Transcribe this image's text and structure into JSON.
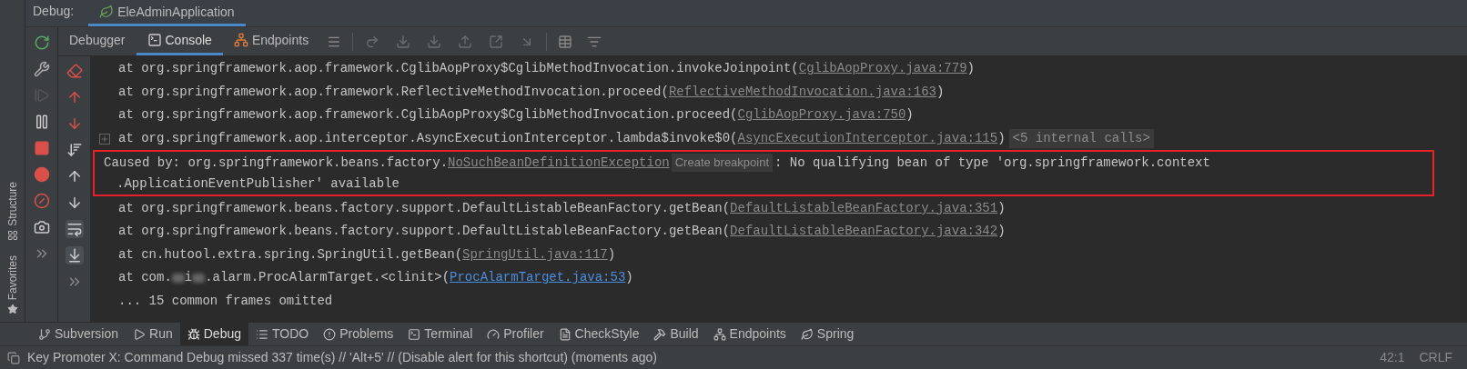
{
  "header": {
    "label": "Debug:",
    "tab": {
      "title": "EleAdminApplication",
      "selected": true
    }
  },
  "side_strip": [
    "Structure",
    "Favorites"
  ],
  "tabs": [
    {
      "label": "Debugger",
      "selected": false
    },
    {
      "label": "Console",
      "selected": true
    },
    {
      "label": "Endpoints",
      "selected": false
    }
  ],
  "console_lines": [
    {
      "kind": "frame",
      "text": "at org.springframework.aop.framework.CglibAopProxy$CglibMethodInvocation.invokeJoinpoint(",
      "link": "CglibAopProxy.java:779",
      "in_project": false,
      "close": ")"
    },
    {
      "kind": "frame",
      "text": "at org.springframework.aop.framework.ReflectiveMethodInvocation.proceed(",
      "link": "ReflectiveMethodInvocation.java:163",
      "in_project": false,
      "close": ")"
    },
    {
      "kind": "frame",
      "text": "at org.springframework.aop.framework.CglibAopProxy$CglibMethodInvocation.proceed(",
      "link": "CglibAopProxy.java:750",
      "in_project": false,
      "close": ")"
    },
    {
      "kind": "frame",
      "folded": true,
      "text": "at org.springframework.aop.interceptor.AsyncExecutionInterceptor.lambda$invoke$0(",
      "link": "AsyncExecutionInterceptor.java:115",
      "in_project": false,
      "close": ")",
      "badge": "<5 internal calls>"
    },
    {
      "kind": "caused",
      "highlighted": true,
      "prefix": "Caused by: org.springframework.beans.factory.",
      "exception": "NoSuchBeanDefinitionException",
      "hint": "Create breakpoint",
      "message": ": No qualifying bean of type 'org.springframework.context",
      "continuation": ".ApplicationEventPublisher' available"
    },
    {
      "kind": "frame",
      "text": "at org.springframework.beans.factory.support.DefaultListableBeanFactory.getBean(",
      "link": "DefaultListableBeanFactory.java:351",
      "in_project": false,
      "close": ")"
    },
    {
      "kind": "frame",
      "text": "at org.springframework.beans.factory.support.DefaultListableBeanFactory.getBean(",
      "link": "DefaultListableBeanFactory.java:342",
      "in_project": false,
      "close": ")"
    },
    {
      "kind": "frame",
      "text": "at cn.hutool.extra.spring.SpringUtil.getBean(",
      "link": "SpringUtil.java:117",
      "in_project": false,
      "close": ")"
    },
    {
      "kind": "redacted_frame",
      "parts": [
        "at com.",
        "i",
        ".alarm.ProcAlarmTarget.<clinit>("
      ],
      "link": "ProcAlarmTarget.java:53",
      "in_project": true,
      "close": ")"
    },
    {
      "kind": "omitted",
      "text": "... 15 common frames omitted"
    }
  ],
  "tool_windows": [
    {
      "label": "Subversion",
      "selected": false
    },
    {
      "label": "Run",
      "selected": false
    },
    {
      "label": "Debug",
      "selected": true
    },
    {
      "label": "TODO",
      "selected": false
    },
    {
      "label": "Problems",
      "selected": false
    },
    {
      "label": "Terminal",
      "selected": false
    },
    {
      "label": "Profiler",
      "selected": false
    },
    {
      "label": "CheckStyle",
      "selected": false
    },
    {
      "label": "Build",
      "selected": false
    },
    {
      "label": "Endpoints",
      "selected": false
    },
    {
      "label": "Spring",
      "selected": false
    }
  ],
  "status_bar": {
    "message": "Key Promoter X: Command Debug missed 337 time(s) // 'Alt+5' // (Disable alert for this shortcut) (moments ago)",
    "position": "42:1",
    "line_separator": "CRLF"
  }
}
